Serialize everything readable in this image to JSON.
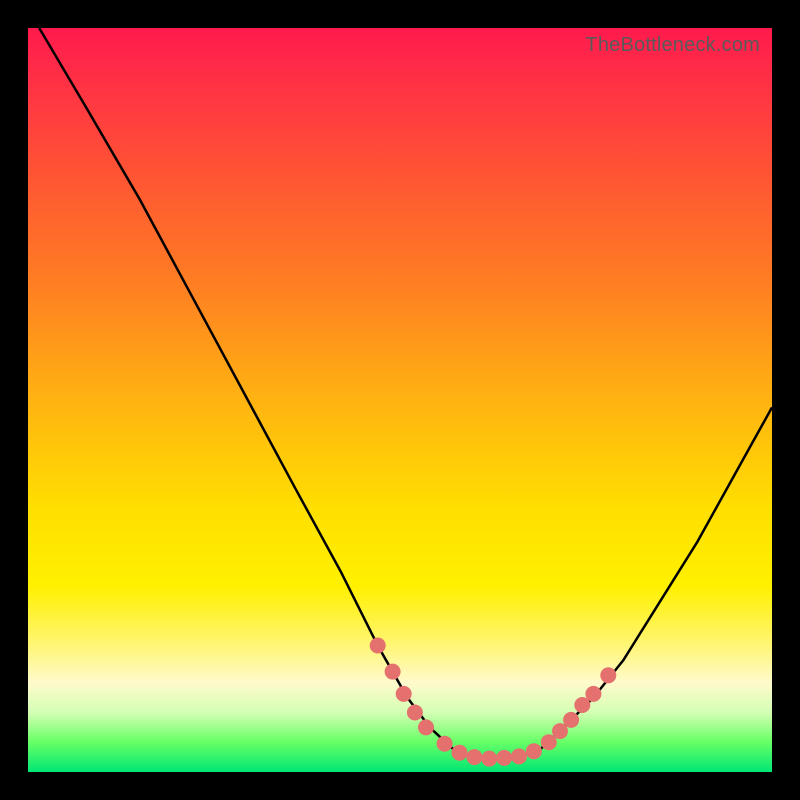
{
  "watermark": "TheBottleneck.com",
  "colors": {
    "background": "#000000",
    "gradient_top": "#ff1a4d",
    "gradient_bottom": "#00e673",
    "curve": "#000000",
    "marker": "#e5716f"
  },
  "chart_data": {
    "type": "line",
    "title": "",
    "xlabel": "",
    "ylabel": "",
    "xlim": [
      0,
      100
    ],
    "ylim": [
      0,
      100
    ],
    "curve": [
      {
        "x": 1.5,
        "y": 100
      },
      {
        "x": 8,
        "y": 89
      },
      {
        "x": 15,
        "y": 77
      },
      {
        "x": 22,
        "y": 64
      },
      {
        "x": 29,
        "y": 51
      },
      {
        "x": 36,
        "y": 38
      },
      {
        "x": 42,
        "y": 27
      },
      {
        "x": 47,
        "y": 17
      },
      {
        "x": 51,
        "y": 10
      },
      {
        "x": 54,
        "y": 6
      },
      {
        "x": 57,
        "y": 3.2
      },
      {
        "x": 60,
        "y": 2
      },
      {
        "x": 63,
        "y": 1.8
      },
      {
        "x": 66,
        "y": 2
      },
      {
        "x": 69,
        "y": 3.2
      },
      {
        "x": 72,
        "y": 6
      },
      {
        "x": 76,
        "y": 10
      },
      {
        "x": 80,
        "y": 15
      },
      {
        "x": 85,
        "y": 23
      },
      {
        "x": 90,
        "y": 31
      },
      {
        "x": 95,
        "y": 40
      },
      {
        "x": 100,
        "y": 49
      }
    ],
    "markers": [
      {
        "x": 47,
        "y": 17
      },
      {
        "x": 49,
        "y": 13.5
      },
      {
        "x": 50.5,
        "y": 10.5
      },
      {
        "x": 52,
        "y": 8
      },
      {
        "x": 53.5,
        "y": 6
      },
      {
        "x": 56,
        "y": 3.8
      },
      {
        "x": 58,
        "y": 2.6
      },
      {
        "x": 60,
        "y": 2
      },
      {
        "x": 62,
        "y": 1.8
      },
      {
        "x": 64,
        "y": 1.9
      },
      {
        "x": 66,
        "y": 2.1
      },
      {
        "x": 68,
        "y": 2.8
      },
      {
        "x": 70,
        "y": 4
      },
      {
        "x": 71.5,
        "y": 5.5
      },
      {
        "x": 73,
        "y": 7
      },
      {
        "x": 74.5,
        "y": 9
      },
      {
        "x": 76,
        "y": 10.5
      },
      {
        "x": 78,
        "y": 13
      }
    ]
  }
}
